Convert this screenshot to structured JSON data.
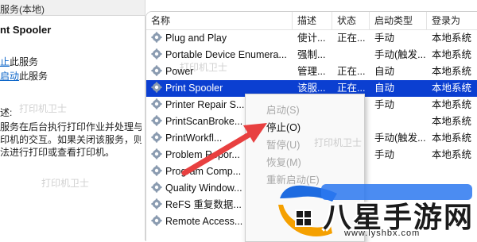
{
  "left": {
    "header": "服务(本地)",
    "service_title": "nt Spooler",
    "link1_prefix": "止",
    "link1_suffix": "此服务",
    "link2_prefix": "启动",
    "link2_suffix": "此服务",
    "desc_label": "述:",
    "desc_lines": [
      "服务在后台执行打印作业并处理与",
      "印机的交互。如果关闭该服务，则",
      "法进行打印或查看打印机。"
    ]
  },
  "table": {
    "columns": [
      "名称",
      "描述",
      "状态",
      "启动类型",
      "登录为"
    ],
    "rows": [
      {
        "name": "Plug and Play",
        "desc": "使计...",
        "status": "正在...",
        "startup": "手动",
        "logon": "本地系统",
        "selected": false
      },
      {
        "name": "Portable Device Enumera...",
        "desc": "强制...",
        "status": "",
        "startup": "手动(触发...",
        "logon": "本地系统",
        "selected": false
      },
      {
        "name": "Power",
        "desc": "管理...",
        "status": "正在...",
        "startup": "自动",
        "logon": "本地系统",
        "selected": false
      },
      {
        "name": "Print Spooler",
        "desc": "该服...",
        "status": "正在...",
        "startup": "自动",
        "logon": "本地系统",
        "selected": true
      },
      {
        "name": "Printer Repair S...",
        "desc": "",
        "status": "",
        "startup": "手动",
        "logon": "本地系统",
        "selected": false
      },
      {
        "name": "PrintScanBroke...",
        "desc": "",
        "status": "",
        "startup": "",
        "logon": "本地系统",
        "selected": false
      },
      {
        "name": "PrintWorkfl...",
        "desc": "",
        "status": "",
        "startup": "手动(触发...",
        "logon": "本地系统",
        "selected": false
      },
      {
        "name": "Problem Repor...",
        "desc": "",
        "status": "",
        "startup": "手动",
        "logon": "本地系统",
        "selected": false
      },
      {
        "name": "Program Comp...",
        "desc": "",
        "status": "",
        "startup": "",
        "logon": "",
        "selected": false
      },
      {
        "name": "Quality Window...",
        "desc": "",
        "status": "",
        "startup": "",
        "logon": "",
        "selected": false
      },
      {
        "name": "ReFS 重复数据...",
        "desc": "",
        "status": "",
        "startup": "",
        "logon": "",
        "selected": false
      },
      {
        "name": "Remote Access...",
        "desc": "",
        "status": "",
        "startup": "",
        "logon": "",
        "selected": false
      }
    ]
  },
  "context_menu": {
    "items": [
      {
        "label": "启动(S)",
        "enabled": false
      },
      {
        "label": "停止(O)",
        "enabled": true
      },
      {
        "label": "暂停(U)",
        "enabled": false
      },
      {
        "label": "恢复(M)",
        "enabled": false
      },
      {
        "label": "重新启动(E)",
        "enabled": false
      }
    ]
  },
  "watermark": {
    "brand": "打印机卫士",
    "logo_text": "八星手游网",
    "logo_url": "www.lyshbx.com"
  },
  "colors": {
    "selection": "#0b3fd1",
    "arrow": "#e84040",
    "link": "#0a64c8"
  }
}
